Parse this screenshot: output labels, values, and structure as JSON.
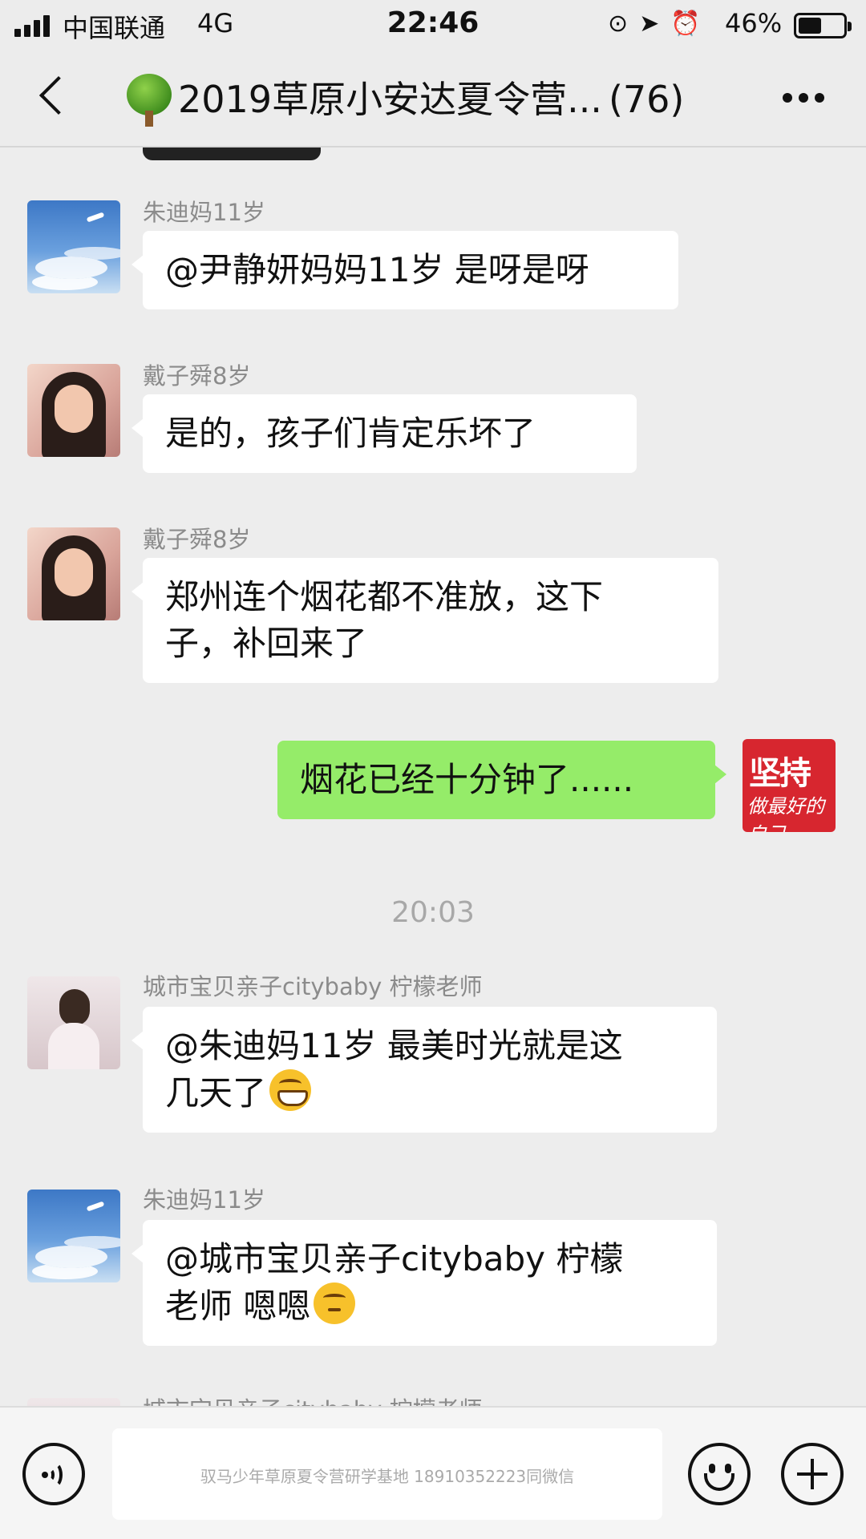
{
  "status_bar": {
    "carrier": "中国联通",
    "network": "4G",
    "time": "22:46",
    "battery_percent": "46%",
    "battery_level": 0.46,
    "icons": [
      "orientation-lock-icon",
      "location-icon",
      "alarm-icon"
    ]
  },
  "nav": {
    "group_icon": "tree-icon",
    "title": "2019草原小安达夏令营...",
    "member_count": "(76)"
  },
  "messages": [
    {
      "sender": "朱迪妈11岁",
      "avatar": "sky",
      "line1": "@尹静妍妈妈11岁 是呀是呀"
    },
    {
      "sender": "戴子舜8岁",
      "avatar": "woman",
      "line1": "是的，孩子们肯定乐坏了"
    },
    {
      "sender": "戴子舜8岁",
      "avatar": "woman",
      "line1": "郑州连个烟花都不准放，这下",
      "line2": "子，补回来了"
    },
    {
      "sender": "",
      "avatar": "jianchi",
      "outgoing": true,
      "line1": "烟花已经十分钟了......"
    },
    {
      "sender": "城市宝贝亲子citybaby 柠檬老师",
      "avatar": "girl",
      "line1": "@朱迪妈11岁 最美时光就是这",
      "line2": "几天了",
      "emoji": "grinning-emoji-icon"
    },
    {
      "sender": "朱迪妈11岁",
      "avatar": "sky",
      "line1": "@城市宝贝亲子citybaby 柠檬",
      "line2": "老师 嗯嗯",
      "emoji": "thinking-emoji-icon"
    },
    {
      "sender": "城市宝贝亲子citybaby 柠檬老师",
      "avatar": "girl"
    }
  ],
  "self_avatar": {
    "line1": "坚持",
    "line2": "做最好的自己"
  },
  "time_separator": "20:03",
  "input_bar": {
    "voice_icon": "voice-icon",
    "watermark": "驭马少年草原夏令营研学基地 18910352223同微信",
    "emoji_icon": "smile-icon",
    "more_icon": "plus-icon"
  }
}
